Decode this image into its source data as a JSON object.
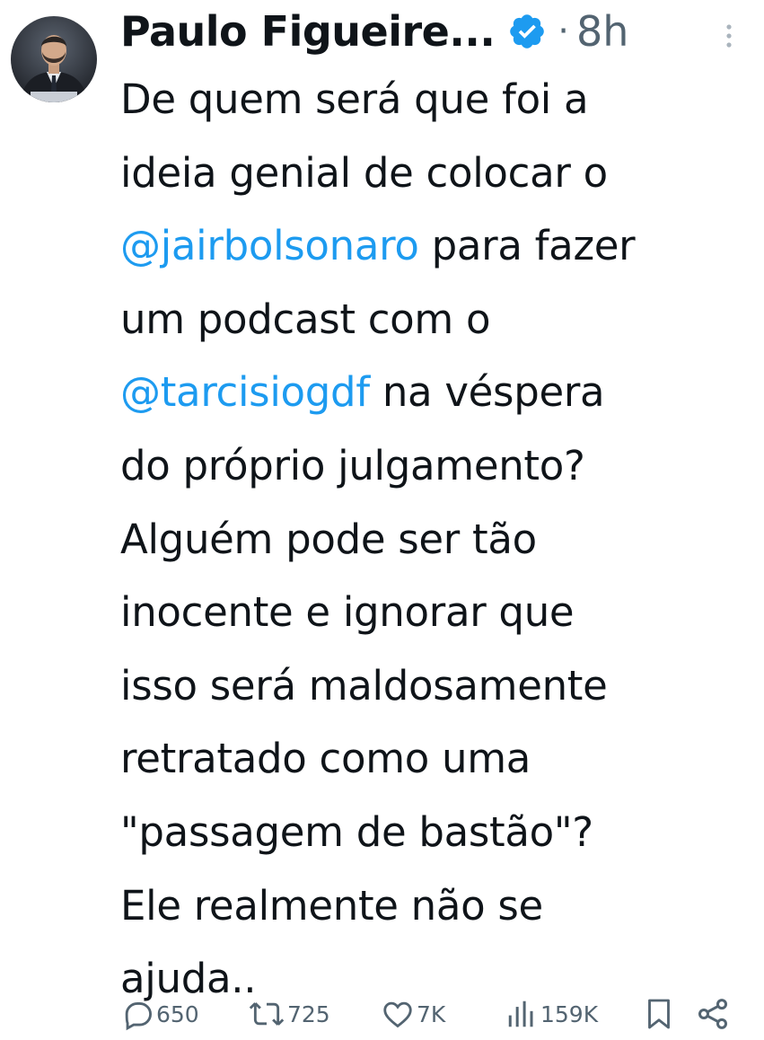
{
  "tweet": {
    "author_name": "Paulo Figueire...",
    "verified": true,
    "separator": "·",
    "timestamp": "8h",
    "body": {
      "line1": "De quem será que foi a",
      "line2": "ideia genial de colocar o",
      "line3_mention": "@jairbolsonaro",
      "line3_rest": " para fazer",
      "line4": "um podcast com o",
      "line5_mention": "@tarcisiogdf",
      "line5_rest": " na véspera",
      "line6": "do próprio julgamento?",
      "line7": "Alguém pode ser tão",
      "line8": "inocente e ignorar que",
      "line9": "isso será maldosamente",
      "line10": "retratado como uma",
      "line11": "\"passagem de bastão\"?",
      "line12": "Ele realmente não se",
      "line13": "ajuda.."
    },
    "actions": {
      "replies": "650",
      "retweets": "725",
      "likes": "7K",
      "views": "159K"
    },
    "icons": {
      "reply": "speech-bubble-icon",
      "retweet": "retweet-arrows-icon",
      "like": "heart-icon",
      "views": "bar-chart-icon",
      "bookmark": "bookmark-icon",
      "share": "share-icon",
      "more": "vertical-dots-icon",
      "verified": "verified-badge-icon"
    },
    "colors": {
      "text": "#0f1419",
      "muted": "#536471",
      "accent": "#1d9bf0"
    }
  }
}
